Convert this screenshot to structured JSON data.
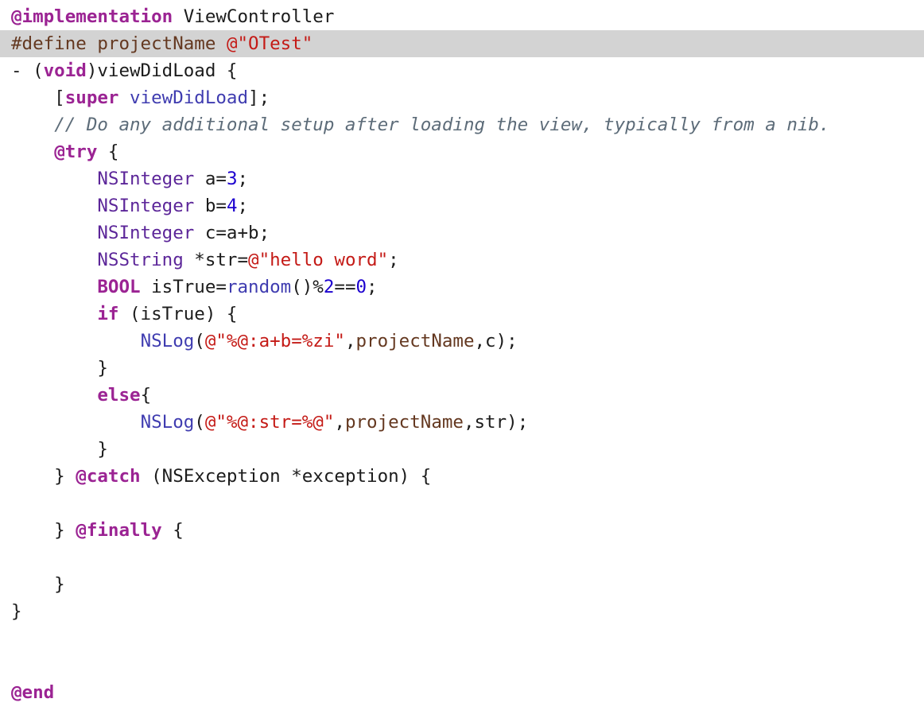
{
  "editor": {
    "language": "objective-c",
    "highlighted_line": 1,
    "colors": {
      "background": "#ffffff",
      "line_highlight": "#d3d3d3",
      "keyword": "#9b2393",
      "preprocessor": "#643820",
      "string": "#c41a16",
      "number": "#1c00cf",
      "type": "#5c2699",
      "function": "#3f3cb0",
      "comment": "#5d6c79",
      "plain": "#1c1c1c"
    },
    "lines": [
      [
        {
          "t": "keyword",
          "v": "@implementation"
        },
        {
          "t": "plain",
          "v": " ViewController"
        }
      ],
      [
        {
          "t": "preproc",
          "v": "#define projectName "
        },
        {
          "t": "string",
          "v": "@\"OTest\""
        }
      ],
      [
        {
          "t": "plain",
          "v": "- ("
        },
        {
          "t": "keyword",
          "v": "void"
        },
        {
          "t": "plain",
          "v": ")viewDidLoad {"
        }
      ],
      [
        {
          "t": "plain",
          "v": "    ["
        },
        {
          "t": "keyword",
          "v": "super"
        },
        {
          "t": "plain",
          "v": " "
        },
        {
          "t": "func",
          "v": "viewDidLoad"
        },
        {
          "t": "plain",
          "v": "];"
        }
      ],
      [
        {
          "t": "plain",
          "v": "    "
        },
        {
          "t": "comment",
          "v": "// Do any additional setup after loading the view, typically from a nib."
        }
      ],
      [
        {
          "t": "plain",
          "v": "    "
        },
        {
          "t": "keyword",
          "v": "@try"
        },
        {
          "t": "plain",
          "v": " {"
        }
      ],
      [
        {
          "t": "plain",
          "v": "        "
        },
        {
          "t": "type",
          "v": "NSInteger"
        },
        {
          "t": "plain",
          "v": " a="
        },
        {
          "t": "number",
          "v": "3"
        },
        {
          "t": "plain",
          "v": ";"
        }
      ],
      [
        {
          "t": "plain",
          "v": "        "
        },
        {
          "t": "type",
          "v": "NSInteger"
        },
        {
          "t": "plain",
          "v": " b="
        },
        {
          "t": "number",
          "v": "4"
        },
        {
          "t": "plain",
          "v": ";"
        }
      ],
      [
        {
          "t": "plain",
          "v": "        "
        },
        {
          "t": "type",
          "v": "NSInteger"
        },
        {
          "t": "plain",
          "v": " c=a+b;"
        }
      ],
      [
        {
          "t": "plain",
          "v": "        "
        },
        {
          "t": "type",
          "v": "NSString"
        },
        {
          "t": "plain",
          "v": " *str="
        },
        {
          "t": "string",
          "v": "@\"hello word\""
        },
        {
          "t": "plain",
          "v": ";"
        }
      ],
      [
        {
          "t": "plain",
          "v": "        "
        },
        {
          "t": "keyword",
          "v": "BOOL"
        },
        {
          "t": "plain",
          "v": " isTrue="
        },
        {
          "t": "func",
          "v": "random"
        },
        {
          "t": "plain",
          "v": "()%"
        },
        {
          "t": "number",
          "v": "2"
        },
        {
          "t": "plain",
          "v": "=="
        },
        {
          "t": "number",
          "v": "0"
        },
        {
          "t": "plain",
          "v": ";"
        }
      ],
      [
        {
          "t": "plain",
          "v": "        "
        },
        {
          "t": "keyword",
          "v": "if"
        },
        {
          "t": "plain",
          "v": " (isTrue) {"
        }
      ],
      [
        {
          "t": "plain",
          "v": "            "
        },
        {
          "t": "func",
          "v": "NSLog"
        },
        {
          "t": "plain",
          "v": "("
        },
        {
          "t": "string",
          "v": "@\"%@:a+b=%zi\""
        },
        {
          "t": "plain",
          "v": ","
        },
        {
          "t": "macro",
          "v": "projectName"
        },
        {
          "t": "plain",
          "v": ",c);"
        }
      ],
      [
        {
          "t": "plain",
          "v": "        }"
        }
      ],
      [
        {
          "t": "plain",
          "v": "        "
        },
        {
          "t": "keyword",
          "v": "else"
        },
        {
          "t": "plain",
          "v": "{"
        }
      ],
      [
        {
          "t": "plain",
          "v": "            "
        },
        {
          "t": "func",
          "v": "NSLog"
        },
        {
          "t": "plain",
          "v": "("
        },
        {
          "t": "string",
          "v": "@\"%@:str=%@\""
        },
        {
          "t": "plain",
          "v": ","
        },
        {
          "t": "macro",
          "v": "projectName"
        },
        {
          "t": "plain",
          "v": ",str);"
        }
      ],
      [
        {
          "t": "plain",
          "v": "        }"
        }
      ],
      [
        {
          "t": "plain",
          "v": "    } "
        },
        {
          "t": "keyword",
          "v": "@catch"
        },
        {
          "t": "plain",
          "v": " (NSException *exception) {"
        }
      ],
      [],
      [
        {
          "t": "plain",
          "v": "    } "
        },
        {
          "t": "keyword",
          "v": "@finally"
        },
        {
          "t": "plain",
          "v": " {"
        }
      ],
      [],
      [
        {
          "t": "plain",
          "v": "    }"
        }
      ],
      [
        {
          "t": "plain",
          "v": "}"
        }
      ],
      [],
      [],
      [
        {
          "t": "keyword",
          "v": "@end"
        }
      ]
    ]
  }
}
